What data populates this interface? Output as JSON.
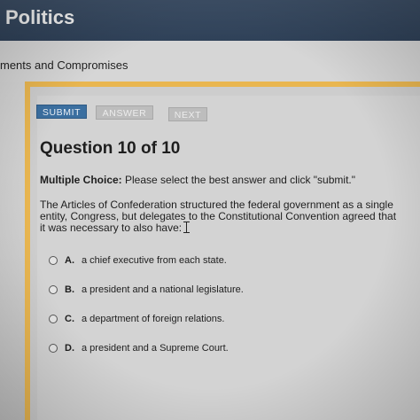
{
  "header": {
    "title": "Politics"
  },
  "subheader": {
    "text": "ments and Compromises"
  },
  "toolbar": {
    "submit_label": "SUBMIT",
    "answer_label": "ANSWER",
    "next_label": "NEXT"
  },
  "question": {
    "title": "Question 10 of 10",
    "type_label": "Multiple Choice:",
    "instruction": "Please select the best answer and click \"submit.\"",
    "text": "The Articles of Confederation structured the federal government as a single entity, Congress, but delegates to the Constitutional Convention agreed that it was necessary to also have:",
    "options": [
      {
        "letter": "A.",
        "text": "a chief executive from each state."
      },
      {
        "letter": "B.",
        "text": "a president and a national legislature."
      },
      {
        "letter": "C.",
        "text": "a department of foreign relations."
      },
      {
        "letter": "D.",
        "text": "a president and a Supreme Court."
      }
    ]
  },
  "colors": {
    "header_bg": "#344860",
    "accent_border": "#e9b650",
    "submit_bg": "#3b6fa0"
  }
}
